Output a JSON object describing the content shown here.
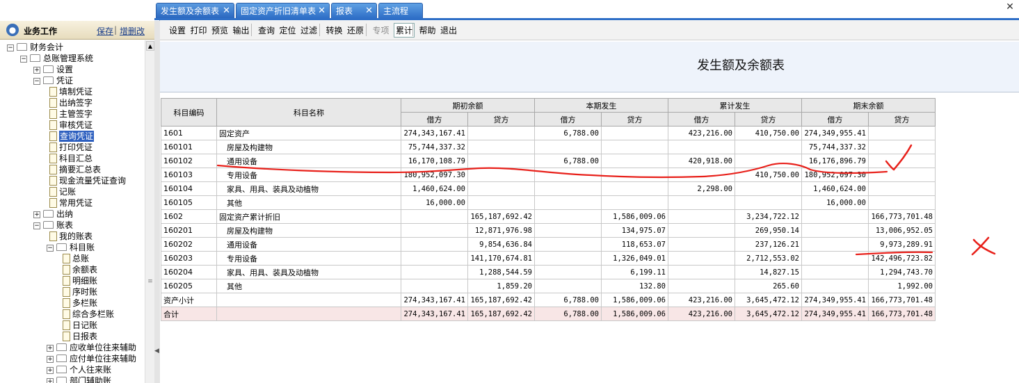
{
  "left_panel": {
    "title": "业务工作",
    "links": [
      "保存",
      "增删改"
    ],
    "tree": [
      {
        "label": "财务会计",
        "level": 0,
        "type": "folder",
        "exp": "-"
      },
      {
        "label": "总账管理系统",
        "level": 1,
        "type": "folder",
        "exp": "-"
      },
      {
        "label": "设置",
        "level": 2,
        "type": "folder",
        "exp": "+"
      },
      {
        "label": "凭证",
        "level": 2,
        "type": "folder",
        "exp": "-"
      },
      {
        "label": "填制凭证",
        "level": 3,
        "type": "file"
      },
      {
        "label": "出纳签字",
        "level": 3,
        "type": "file"
      },
      {
        "label": "主管签字",
        "level": 3,
        "type": "file"
      },
      {
        "label": "审核凭证",
        "level": 3,
        "type": "file"
      },
      {
        "label": "查询凭证",
        "level": 3,
        "type": "file",
        "selected": true
      },
      {
        "label": "打印凭证",
        "level": 3,
        "type": "file"
      },
      {
        "label": "科目汇总",
        "level": 3,
        "type": "file"
      },
      {
        "label": "摘要汇总表",
        "level": 3,
        "type": "file"
      },
      {
        "label": "现金流量凭证查询",
        "level": 3,
        "type": "file"
      },
      {
        "label": "记账",
        "level": 3,
        "type": "file"
      },
      {
        "label": "常用凭证",
        "level": 3,
        "type": "file"
      },
      {
        "label": "出纳",
        "level": 2,
        "type": "folder",
        "exp": "+"
      },
      {
        "label": "账表",
        "level": 2,
        "type": "folder",
        "exp": "-"
      },
      {
        "label": "我的账表",
        "level": 3,
        "type": "file"
      },
      {
        "label": "科目账",
        "level": 3,
        "type": "folder",
        "exp": "-"
      },
      {
        "label": "总账",
        "level": 4,
        "type": "file"
      },
      {
        "label": "余额表",
        "level": 4,
        "type": "file"
      },
      {
        "label": "明细账",
        "level": 4,
        "type": "file"
      },
      {
        "label": "序时账",
        "level": 4,
        "type": "file"
      },
      {
        "label": "多栏账",
        "level": 4,
        "type": "file"
      },
      {
        "label": "综合多栏账",
        "level": 4,
        "type": "file"
      },
      {
        "label": "日记账",
        "level": 4,
        "type": "file"
      },
      {
        "label": "日报表",
        "level": 4,
        "type": "file"
      },
      {
        "label": "应收单位往来辅助",
        "level": 3,
        "type": "folder",
        "exp": "+"
      },
      {
        "label": "应付单位往来辅助",
        "level": 3,
        "type": "folder",
        "exp": "+"
      },
      {
        "label": "个人往来账",
        "level": 3,
        "type": "folder",
        "exp": "+"
      },
      {
        "label": "部门辅助账",
        "level": 3,
        "type": "folder",
        "exp": "+"
      }
    ]
  },
  "tabs": [
    {
      "label": "发生额及余额表",
      "active": true,
      "close": true
    },
    {
      "label": "固定资产折旧清单表",
      "close": true
    },
    {
      "label": "报表",
      "close": true
    },
    {
      "label": "主流程",
      "close": false
    }
  ],
  "toolbar": {
    "groups": [
      [
        "设置",
        "打印",
        "预览",
        "输出"
      ],
      [
        "查询",
        "定位",
        "过滤"
      ],
      [
        "转换",
        "还原"
      ],
      [
        "专项",
        "累计"
      ],
      [
        "帮助",
        "退出"
      ]
    ],
    "disabled": [
      "专项"
    ],
    "pressed": [
      "累计"
    ]
  },
  "report": {
    "title": "发生额及余额表",
    "header": {
      "code": "科目编码",
      "name": "科目名称",
      "groups": [
        "期初余额",
        "本期发生",
        "累计发生",
        "期末余额"
      ],
      "debit": "借方",
      "credit": "贷方"
    },
    "rows": [
      {
        "code": "1601",
        "name": "固定资产",
        "indent": false,
        "v": [
          "274,343,167.41",
          "",
          "6,788.00",
          "",
          "423,216.00",
          "410,750.00",
          "274,349,955.41",
          ""
        ]
      },
      {
        "code": "160101",
        "name": "房屋及构建物",
        "indent": true,
        "v": [
          "75,744,337.32",
          "",
          "",
          "",
          "",
          "",
          "75,744,337.32",
          ""
        ]
      },
      {
        "code": "160102",
        "name": "通用设备",
        "indent": true,
        "v": [
          "16,170,108.79",
          "",
          "6,788.00",
          "",
          "420,918.00",
          "",
          "16,176,896.79",
          ""
        ]
      },
      {
        "code": "160103",
        "name": "专用设备",
        "indent": true,
        "v": [
          "180,952,097.30",
          "",
          "",
          "",
          "",
          "410,750.00",
          "180,952,097.30",
          ""
        ]
      },
      {
        "code": "160104",
        "name": "家具、用具、装具及动植物",
        "indent": true,
        "v": [
          "1,460,624.00",
          "",
          "",
          "",
          "2,298.00",
          "",
          "1,460,624.00",
          ""
        ]
      },
      {
        "code": "160105",
        "name": "其他",
        "indent": true,
        "v": [
          "16,000.00",
          "",
          "",
          "",
          "",
          "",
          "16,000.00",
          ""
        ]
      },
      {
        "code": "1602",
        "name": "固定资产累计折旧",
        "indent": false,
        "v": [
          "",
          "165,187,692.42",
          "",
          "1,586,009.06",
          "",
          "3,234,722.12",
          "",
          "166,773,701.48"
        ]
      },
      {
        "code": "160201",
        "name": "房屋及构建物",
        "indent": true,
        "v": [
          "",
          "12,871,976.98",
          "",
          "134,975.07",
          "",
          "269,950.14",
          "",
          "13,006,952.05"
        ]
      },
      {
        "code": "160202",
        "name": "通用设备",
        "indent": true,
        "v": [
          "",
          "9,854,636.84",
          "",
          "118,653.07",
          "",
          "237,126.21",
          "",
          "9,973,289.91"
        ]
      },
      {
        "code": "160203",
        "name": "专用设备",
        "indent": true,
        "v": [
          "",
          "141,170,674.81",
          "",
          "1,326,049.01",
          "",
          "2,712,553.02",
          "",
          "142,496,723.82"
        ]
      },
      {
        "code": "160204",
        "name": "家具、用具、装具及动植物",
        "indent": true,
        "v": [
          "",
          "1,288,544.59",
          "",
          "6,199.11",
          "",
          "14,827.15",
          "",
          "1,294,743.70"
        ]
      },
      {
        "code": "160205",
        "name": "其他",
        "indent": true,
        "v": [
          "",
          "1,859.20",
          "",
          "132.80",
          "",
          "265.60",
          "",
          "1,992.00"
        ]
      },
      {
        "code": "资产小计",
        "name": "",
        "indent": false,
        "v": [
          "274,343,167.41",
          "165,187,692.42",
          "6,788.00",
          "1,586,009.06",
          "423,216.00",
          "3,645,472.12",
          "274,349,955.41",
          "166,773,701.48"
        ]
      },
      {
        "code": "合计",
        "name": "",
        "indent": false,
        "total": true,
        "v": [
          "274,343,167.41",
          "165,187,692.42",
          "6,788.00",
          "1,586,009.06",
          "423,216.00",
          "3,645,472.12",
          "274,349,955.41",
          "166,773,701.48"
        ]
      }
    ]
  },
  "colors": {
    "tab_blue": "#2f6fc7",
    "ink_red": "#e8201a",
    "selection": "#2d5fbf",
    "total_row": "#f8e6e6"
  }
}
